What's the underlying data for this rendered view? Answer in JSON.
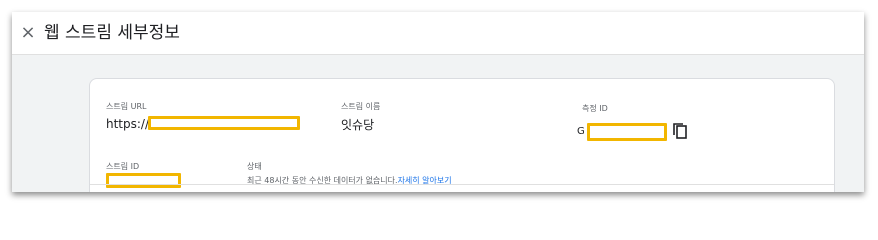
{
  "header": {
    "close_icon": "×",
    "title": "웹 스트림 세부정보"
  },
  "stream": {
    "url_label": "스트림 URL",
    "url_value": "https://",
    "name_label": "스트림 이름",
    "name_value": "잇슈당",
    "measurement_label": "측정 ID",
    "measurement_prefix": "G",
    "id_label": "스트림 ID",
    "status_label": "상태",
    "status_text": "최근 48시간 동안 수신한 데이터가 없습니다.",
    "status_link": "자세히 알아보기"
  },
  "colors": {
    "redaction_border": "#f2b600",
    "link": "#1a73e8"
  },
  "icons": {
    "close": "close-icon",
    "copy": "copy-icon"
  }
}
